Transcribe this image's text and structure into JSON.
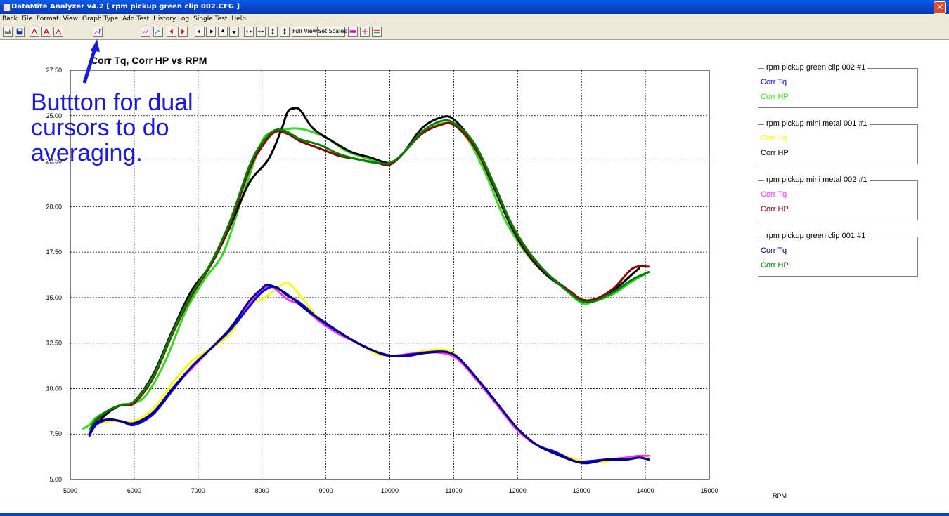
{
  "window": {
    "title": "DataMite Analyzer v4.2  [ rpm pickup green clip 002.CFG ]",
    "close_glyph": "✕"
  },
  "menu": [
    "Back",
    "File",
    "Format",
    "View",
    "Graph Type",
    "Add Test",
    "History Log",
    "Single Test",
    "Help"
  ],
  "toolbar": {
    "full_view": "Full View",
    "set_scales": "Set Scales",
    "icons": [
      "print-icon",
      "save-icon",
      "graph-a-icon",
      "graph-b-icon",
      "graph-c-icon",
      "dual-cursor-icon",
      "zoom-graph-icon",
      "graph-scale-icon",
      "left-cursor-icon",
      "right-cursor-icon",
      "pan-left-icon",
      "pan-right-icon",
      "pan-up-icon",
      "pan-down-icon",
      "stretch-horizontal-icon",
      "shrink-horizontal-icon",
      "stretch-vertical-icon",
      "shrink-vertical-icon",
      "color-settings-icon",
      "markers-icon",
      "line-style-icon"
    ]
  },
  "annotation": "Buttton for dual\ncursors to do\naveraging.",
  "legend": [
    {
      "title": "rpm pickup green clip 002   #1",
      "items": [
        {
          "label": "Corr Tq",
          "color": "#0000ff"
        },
        {
          "label": "Corr HP",
          "color": "#33dd22"
        }
      ]
    },
    {
      "title": "rpm pickup mini metal 001   #1",
      "items": [
        {
          "label": "Corr Tq",
          "color": "#ffff00"
        },
        {
          "label": "Corr HP",
          "color": "#000000"
        }
      ]
    },
    {
      "title": "rpm pickup mini metal 002   #1",
      "items": [
        {
          "label": "Corr Tq",
          "color": "#ff33ff"
        },
        {
          "label": "Corr HP",
          "color": "#8b0000"
        }
      ]
    },
    {
      "title": "rpm pickup green clip 001   #1",
      "items": [
        {
          "label": "Corr Tq",
          "color": "#000080"
        },
        {
          "label": "Corr HP",
          "color": "#008000"
        }
      ]
    }
  ],
  "chart_data": {
    "type": "line",
    "title": "Corr Tq, Corr HP vs RPM",
    "xlabel": "RPM",
    "ylabel": "",
    "xlim": [
      5000,
      15000
    ],
    "ylim": [
      5.0,
      27.5
    ],
    "x_ticks": [
      "5000",
      "6000",
      "7000",
      "8000",
      "9000",
      "10000",
      "11000",
      "12000",
      "13000",
      "14000",
      "15000"
    ],
    "y_ticks": [
      "5.00",
      "7.50",
      "10.00",
      "12.50",
      "15.00",
      "17.50",
      "20.00",
      "22.50",
      "25.00",
      "27.50"
    ],
    "grid": true,
    "series": [
      {
        "name": "Corr HP",
        "file": "rpm pickup green clip 002",
        "color": "#33dd22",
        "x": [
          5200,
          5300,
          5400,
          5600,
          5800,
          6000,
          6200,
          6500,
          6800,
          7100,
          7400,
          7700,
          8000,
          8200,
          8300,
          8500,
          8700,
          9000,
          9300,
          9600,
          9800,
          10000,
          10200,
          10500,
          10900,
          11200,
          11500,
          11800,
          12100,
          12400,
          12700,
          13000,
          13200,
          13500,
          13800,
          14050
        ],
        "y": [
          7.8,
          8.0,
          8.4,
          8.8,
          9.1,
          9.2,
          9.7,
          11.6,
          14.2,
          16.0,
          17.5,
          20.6,
          23.6,
          24.1,
          24.2,
          24.3,
          24.2,
          23.8,
          23.1,
          22.7,
          22.5,
          22.4,
          22.9,
          24.0,
          24.6,
          23.8,
          21.8,
          19.3,
          17.6,
          16.4,
          15.6,
          14.7,
          14.8,
          15.2,
          15.9,
          16.4
        ]
      },
      {
        "name": "Corr HP",
        "file": "rpm pickup mini metal 001",
        "color": "#000000",
        "x": [
          5300,
          5400,
          5600,
          5800,
          6000,
          6300,
          6600,
          6900,
          7200,
          7500,
          7800,
          8100,
          8300,
          8400,
          8500,
          8600,
          8800,
          9100,
          9400,
          9700,
          10000,
          10200,
          10500,
          10800,
          11000,
          11300,
          11600,
          11900,
          12200,
          12500,
          12800,
          13000,
          13200,
          13500,
          13800,
          13900
        ],
        "y": [
          7.5,
          8.0,
          8.7,
          9.1,
          9.3,
          10.8,
          13.2,
          15.4,
          16.8,
          18.9,
          21.3,
          22.6,
          24.2,
          25.2,
          25.4,
          25.3,
          24.3,
          23.6,
          23.0,
          22.7,
          22.4,
          22.9,
          24.3,
          24.9,
          24.8,
          23.5,
          21.3,
          18.9,
          17.2,
          16.1,
          15.4,
          14.9,
          14.9,
          15.4,
          16.3,
          16.6
        ]
      },
      {
        "name": "Corr HP",
        "file": "rpm pickup mini metal 002",
        "color": "#8b0000",
        "x": [
          5300,
          5400,
          5600,
          5800,
          6000,
          6300,
          6600,
          6900,
          7200,
          7500,
          7800,
          8000,
          8200,
          8400,
          8600,
          8900,
          9200,
          9500,
          9800,
          10000,
          10200,
          10500,
          10800,
          11000,
          11300,
          11600,
          11900,
          12200,
          12500,
          12800,
          13000,
          13200,
          13500,
          13800,
          14050
        ],
        "y": [
          7.6,
          8.2,
          8.8,
          9.1,
          9.2,
          10.6,
          13.0,
          15.1,
          16.8,
          19.0,
          22.0,
          23.3,
          24.1,
          24.0,
          23.6,
          23.2,
          22.8,
          22.6,
          22.4,
          22.3,
          22.9,
          24.0,
          24.5,
          24.5,
          23.4,
          21.4,
          19.0,
          17.3,
          16.2,
          15.4,
          14.9,
          14.9,
          15.5,
          16.6,
          16.7
        ]
      },
      {
        "name": "Corr HP",
        "file": "rpm pickup green clip 001",
        "color": "#008000",
        "x": [
          5300,
          5400,
          5600,
          5800,
          6000,
          6300,
          6600,
          6900,
          7200,
          7500,
          7800,
          8000,
          8200,
          8400,
          8600,
          8900,
          9200,
          9500,
          9800,
          10000,
          10200,
          10500,
          10800,
          11000,
          11300,
          11600,
          11900,
          12200,
          12500,
          12800,
          13000,
          13200,
          13500,
          13800,
          14050
        ],
        "y": [
          7.7,
          8.3,
          8.8,
          9.1,
          9.3,
          10.7,
          13.1,
          15.2,
          16.9,
          19.2,
          22.2,
          23.5,
          24.2,
          24.1,
          23.7,
          23.4,
          22.9,
          22.6,
          22.4,
          22.4,
          22.9,
          24.1,
          24.7,
          24.6,
          23.6,
          21.5,
          19.1,
          17.4,
          16.2,
          15.3,
          14.8,
          14.8,
          15.3,
          16.0,
          16.4
        ]
      },
      {
        "name": "Corr Tq",
        "file": "rpm pickup mini metal 001",
        "color": "#ffff00",
        "x": [
          5300,
          5400,
          5600,
          5800,
          6000,
          6300,
          6600,
          6900,
          7200,
          7500,
          7800,
          8000,
          8200,
          8400,
          8600,
          8900,
          9200,
          9500,
          9800,
          10000,
          10300,
          10600,
          10900,
          11100,
          11400,
          11700,
          12000,
          12300,
          12600,
          12900,
          13100,
          13400,
          13700,
          13900,
          14050
        ],
        "y": [
          7.6,
          8.0,
          8.2,
          8.2,
          8.2,
          8.9,
          10.3,
          11.5,
          12.2,
          13.0,
          14.6,
          14.9,
          15.4,
          15.8,
          15.1,
          13.8,
          13.1,
          12.5,
          11.9,
          11.8,
          11.9,
          12.1,
          12.1,
          11.6,
          10.3,
          9.0,
          7.7,
          6.9,
          6.5,
          6.1,
          6.0,
          6.0,
          6.2,
          6.2,
          6.2
        ]
      },
      {
        "name": "Corr Tq",
        "file": "rpm pickup mini metal 002",
        "color": "#ff33ff",
        "x": [
          5300,
          5400,
          5600,
          5800,
          6000,
          6300,
          6600,
          6900,
          7200,
          7500,
          7800,
          8000,
          8100,
          8200,
          8400,
          8600,
          8900,
          9200,
          9500,
          9800,
          10000,
          10300,
          10600,
          10900,
          11100,
          11400,
          11700,
          12000,
          12300,
          12600,
          12900,
          13100,
          13400,
          13700,
          13900,
          14050
        ],
        "y": [
          7.5,
          8.0,
          8.3,
          8.2,
          8.1,
          8.7,
          10.0,
          11.1,
          12.2,
          13.3,
          14.7,
          15.4,
          15.6,
          15.5,
          14.9,
          14.6,
          13.7,
          13.0,
          12.5,
          12.0,
          11.8,
          11.9,
          12.0,
          11.9,
          11.5,
          10.3,
          9.0,
          7.7,
          6.9,
          6.5,
          6.0,
          6.0,
          6.1,
          6.2,
          6.3,
          6.3
        ]
      },
      {
        "name": "Corr Tq",
        "file": "rpm pickup green clip 002",
        "color": "#0000ff",
        "x": [
          5300,
          5400,
          5600,
          5800,
          6000,
          6300,
          6600,
          6900,
          7200,
          7500,
          7800,
          8000,
          8200,
          8400,
          8600,
          8900,
          9200,
          9500,
          9800,
          10000,
          10300,
          10600,
          10900,
          11100,
          11400,
          11700,
          12000,
          12300,
          12600,
          12900,
          13100,
          13400,
          13700,
          13900,
          14050
        ],
        "y": [
          7.4,
          8.0,
          8.3,
          8.2,
          8.0,
          8.6,
          9.9,
          11.2,
          12.2,
          13.2,
          14.5,
          15.3,
          15.6,
          15.1,
          14.7,
          13.8,
          13.1,
          12.5,
          12.0,
          11.8,
          11.8,
          12.0,
          12.0,
          11.6,
          10.4,
          9.1,
          7.8,
          6.9,
          6.5,
          6.0,
          6.0,
          6.1,
          6.1,
          6.2,
          6.1
        ]
      },
      {
        "name": "Corr Tq",
        "file": "rpm pickup green clip 001",
        "color": "#000080",
        "x": [
          5300,
          5400,
          5600,
          5800,
          6000,
          6300,
          6600,
          6900,
          7200,
          7500,
          7800,
          8000,
          8100,
          8300,
          8500,
          8700,
          9000,
          9300,
          9600,
          9900,
          10100,
          10400,
          10700,
          10900,
          11100,
          11400,
          11700,
          12000,
          12300,
          12600,
          12900,
          13100,
          13400,
          13700,
          13900,
          14050
        ],
        "y": [
          7.5,
          8.1,
          8.3,
          8.2,
          8.1,
          8.7,
          10.0,
          11.2,
          12.2,
          13.3,
          14.8,
          15.5,
          15.7,
          15.4,
          14.9,
          14.3,
          13.6,
          12.9,
          12.3,
          11.9,
          11.8,
          11.9,
          12.0,
          12.0,
          11.6,
          10.4,
          9.1,
          7.8,
          6.9,
          6.4,
          6.0,
          5.9,
          6.1,
          6.1,
          6.2,
          6.1
        ]
      }
    ]
  }
}
